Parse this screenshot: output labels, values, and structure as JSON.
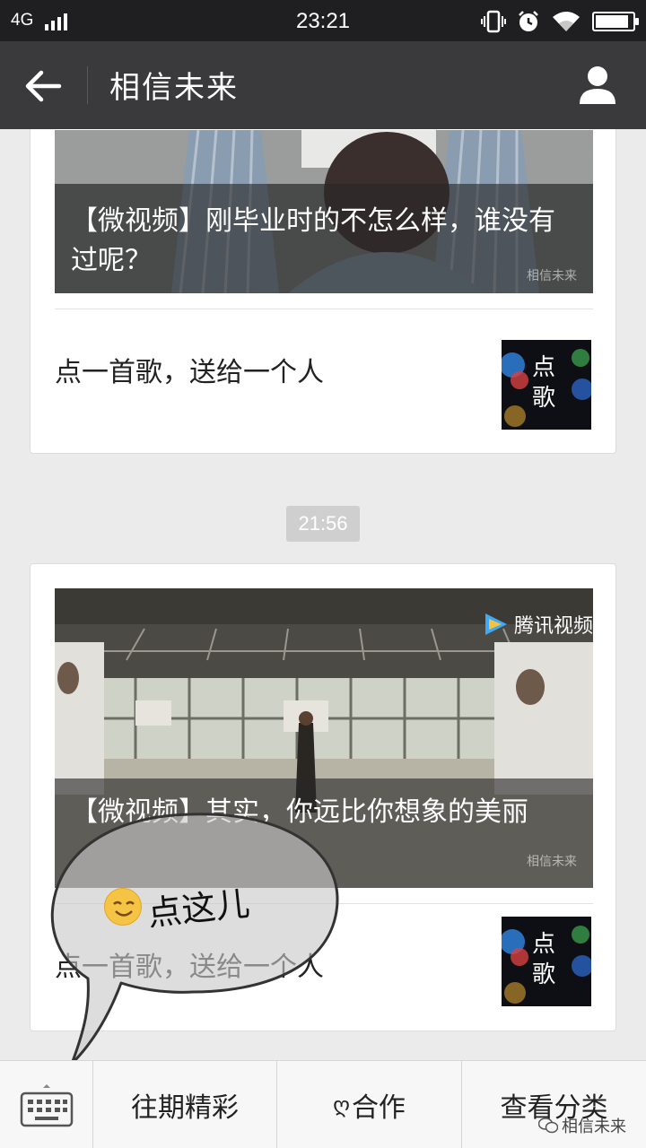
{
  "statusbar": {
    "network": "4G",
    "time": "23:21",
    "battery_level": 0.9,
    "icons": [
      "signal-icon",
      "vibrate-icon",
      "alarm-icon",
      "wifi-icon",
      "battery-icon"
    ]
  },
  "header": {
    "title": "相信未来",
    "icons": [
      "back-arrow-icon",
      "profile-icon"
    ]
  },
  "messages": [
    {
      "cover_caption": "【微视频】刚毕业时的不怎么样，谁没有过呢？",
      "cover_watermark": "相信未来",
      "item_text": "点一首歌，送给一个人",
      "thumb_text": "点\n歌"
    },
    {
      "time_divider": "21:56",
      "cover_caption": "【微视频】其实，你远比你想象的美丽",
      "cover_watermark": "相信未来",
      "video_source": "腾讯视频",
      "item_text": "点一首歌，送给一个人",
      "thumb_text": "点\n歌"
    }
  ],
  "overlay": {
    "bubble_text": "点这儿",
    "emoji": "smile-emoji-icon"
  },
  "bottom_menu": {
    "items": [
      "往期精彩",
      "合作",
      "查看分类"
    ],
    "keyboard_icon": "keyboard-icon",
    "watermark": "相信未来"
  },
  "colors": {
    "status_bg": "#1f1f21",
    "header_bg": "#3a3a3c",
    "page_bg": "#ebebeb",
    "menu_bg": "#f7f7f7"
  }
}
